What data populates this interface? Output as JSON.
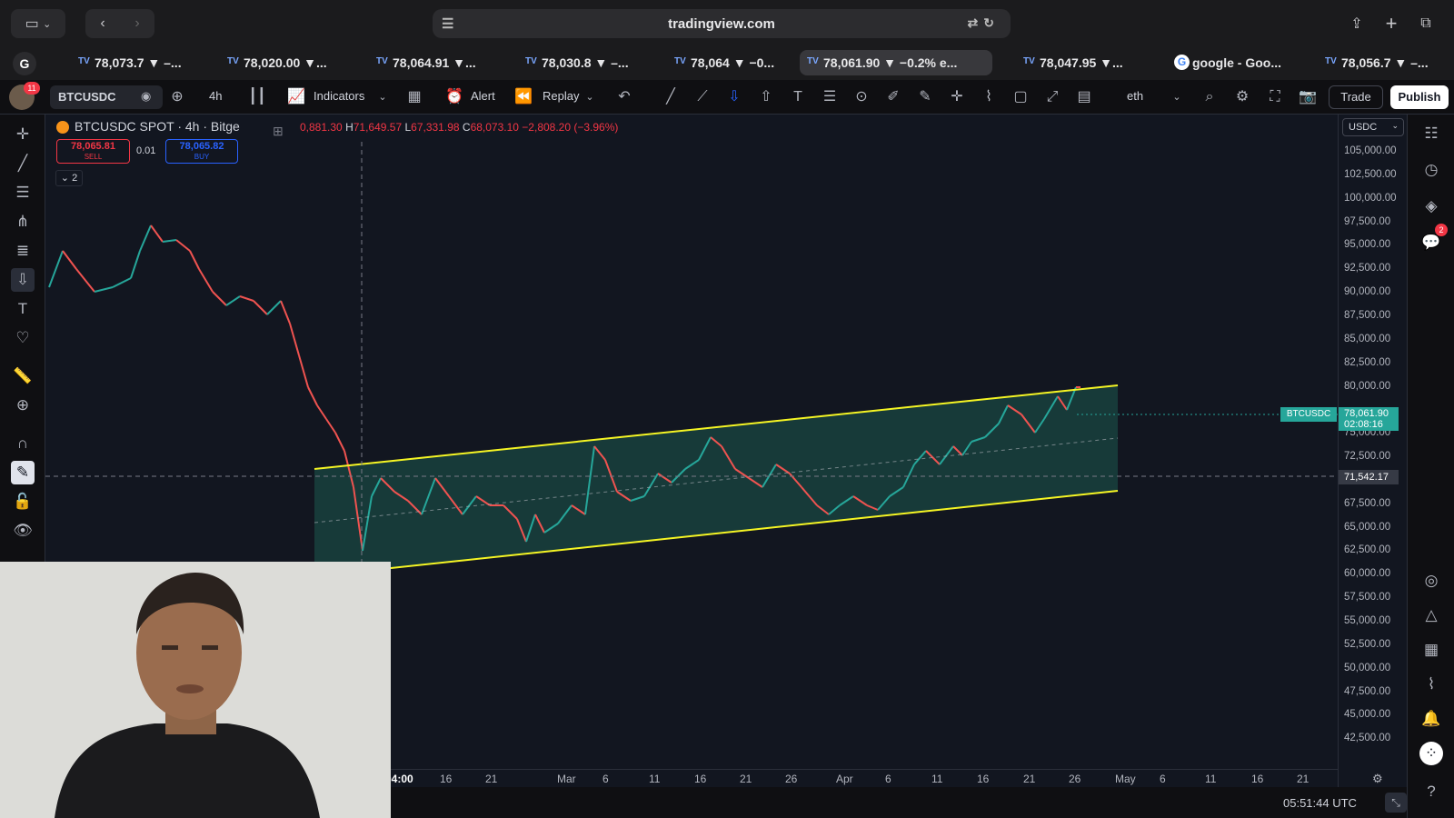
{
  "browser": {
    "url": "tradingview.com",
    "tabs": [
      {
        "label": "78,073.7 ▼ –...",
        "icon": "tradingview-icon"
      },
      {
        "label": "78,020.00 ▼...",
        "icon": "tradingview-icon"
      },
      {
        "label": "78,064.91 ▼...",
        "icon": "tradingview-icon"
      },
      {
        "label": "78,030.8 ▼ –...",
        "icon": "tradingview-icon"
      },
      {
        "label": "78,064 ▼ −0...",
        "icon": "tradingview-icon"
      },
      {
        "label": "78,061.90 ▼ −0.2% e...",
        "icon": "tradingview-icon",
        "active": true
      },
      {
        "label": "78,047.95 ▼...",
        "icon": "tradingview-icon"
      },
      {
        "label": "google - Goo...",
        "icon": "google-icon"
      },
      {
        "label": "78,056.7 ▼ –...",
        "icon": "tradingview-icon"
      }
    ]
  },
  "toolbar": {
    "avatar_badge": "11",
    "symbol": "BTCUSDC",
    "interval": "4h",
    "indicators_label": "Indicators",
    "alert_label": "Alert",
    "replay_label": "Replay",
    "layout_name": "eth",
    "trade_label": "Trade",
    "publish_label": "Publish"
  },
  "legend": {
    "title": "BTCUSDC SPOT · 4h · Bitge",
    "open_prefix": "O",
    "open_value": "0,881.30",
    "high_key": "H",
    "high_value": "71,649.57",
    "low_key": "L",
    "low_value": "67,331.98",
    "close_key": "C",
    "close_value": "68,073.10",
    "change": "−2,808.20 (−3.96%)",
    "sell_price": "78,065.81",
    "sell_label": "SELL",
    "buy_price": "78,065.82",
    "buy_label": "BUY",
    "qty": "0.01",
    "collapse_count": "2"
  },
  "price_scale": {
    "currency": "USDC",
    "labels": [
      "105,000.00",
      "102,500.00",
      "100,000.00",
      "97,500.00",
      "95,000.00",
      "92,500.00",
      "90,000.00",
      "87,500.00",
      "85,000.00",
      "82,500.00",
      "80,000.00",
      "75,000.00",
      "72,500.00",
      "70,000.00",
      "67,500.00",
      "65,000.00",
      "62,500.00",
      "60,000.00",
      "57,500.00",
      "55,000.00",
      "52,500.00",
      "50,000.00",
      "47,500.00",
      "45,000.00",
      "42,500.00"
    ],
    "symbol_tag": "BTCUSDC",
    "last_price": "78,061.90",
    "countdown": "02:08:16",
    "crosshair_price": "71,542.17"
  },
  "time_axis": {
    "labels": [
      "04:00",
      "16",
      "21",
      "Mar",
      "6",
      "11",
      "16",
      "21",
      "26",
      "Apr",
      "6",
      "11",
      "16",
      "21",
      "26",
      "May",
      "6",
      "11",
      "16",
      "21"
    ]
  },
  "status": {
    "clock": "05:51:44 UTC"
  },
  "right_panel": {
    "chat_badge": "2"
  },
  "colors": {
    "channel_line": "#f5f524",
    "channel_fill": "#1a4a44",
    "up_candle": "#26a69a",
    "down_candle": "#ef5350",
    "last_price_tag": "#26a69a"
  }
}
